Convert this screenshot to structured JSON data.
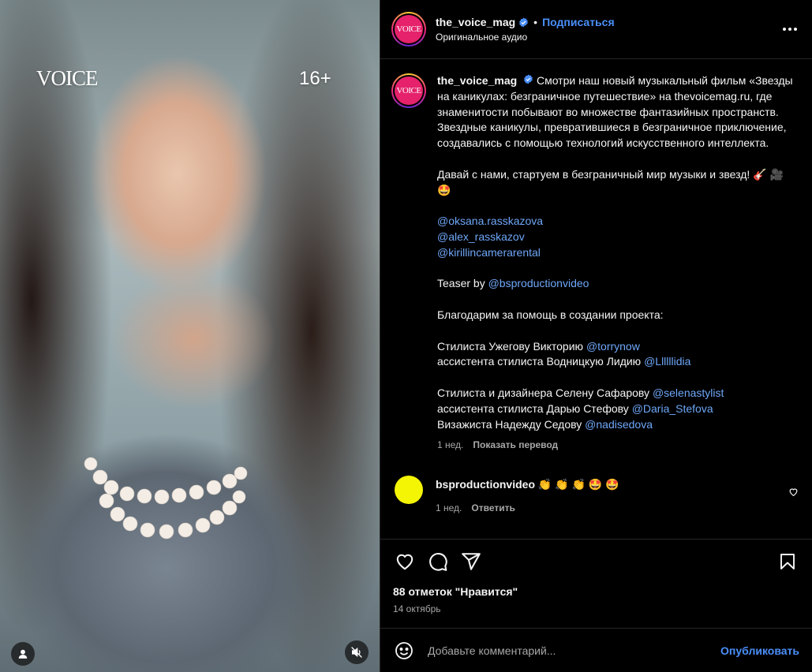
{
  "media": {
    "logo_text": "VOICE",
    "age_rating": "16+",
    "user_tag_icon": "person-icon",
    "mute_icon": "speaker-muted-icon"
  },
  "header": {
    "username": "the_voice_mag",
    "verified_icon": "verified-badge-icon",
    "separator": "•",
    "follow_label": "Подписаться",
    "audio_label": "Оригинальное аудио",
    "avatar_text": "VOICE",
    "more_icon": "more-options-icon"
  },
  "caption": {
    "username": "the_voice_mag",
    "line1": "Смотри наш новый музыкальный фильм «Звезды на каникулах: безграничное путешествие» на thevoicemag.ru, где знаменитости побывают во множестве фантазийных пространств. Звездные каникулы, превратившиеся в безграничное приключение, создавались с помощью технологий искусственного интеллекта.",
    "line2": "Давай с нами, стартуем в безграничный мир музыки и звезд! 🎸 🎥 🤩",
    "mentions": [
      "@oksana.rasskazova",
      "@alex_rasskazov",
      "@kirillincamerarental"
    ],
    "teaser_prefix": "Teaser by ",
    "teaser_mention": "@bsproductionvideo",
    "thanks": "Благодарим за помощь в создании проекта:",
    "credit1_text": "Стилиста Ужегову Викторию ",
    "credit1_mention": "@torrynow",
    "credit2_text": "ассистента стилиста Водницкую Лидию ",
    "credit2_mention": "@Llllllidia",
    "credit3_text": "Стилиста и дизайнера Селену Сафарову ",
    "credit3_mention": "@selenastylist",
    "credit4_text": "ассистента стилиста Дарью Стефову ",
    "credit4_mention": "@Daria_Stefova",
    "credit5_text": "Визажиста Надежду Седову ",
    "credit5_mention": "@nadisedova",
    "time": "1 нед.",
    "translate": "Показать перевод"
  },
  "comment": {
    "username": "bsproductionvideo",
    "text": "👏 👏 👏 🤩 🤩",
    "time": "1 нед.",
    "reply": "Ответить",
    "heart_icon": "heart-icon"
  },
  "actions": {
    "like_icon": "heart-icon",
    "comment_icon": "comment-icon",
    "share_icon": "share-icon",
    "save_icon": "bookmark-icon",
    "likes": "88 отметок \"Нравится\"",
    "date": "14 октябрь"
  },
  "add_comment": {
    "emoji_icon": "smiley-icon",
    "placeholder": "Добавьте комментарий...",
    "publish_label": "Опубликовать"
  },
  "colors": {
    "link": "#4a8ff9",
    "mention": "#6ea7f8",
    "brand": "#e5226b"
  }
}
